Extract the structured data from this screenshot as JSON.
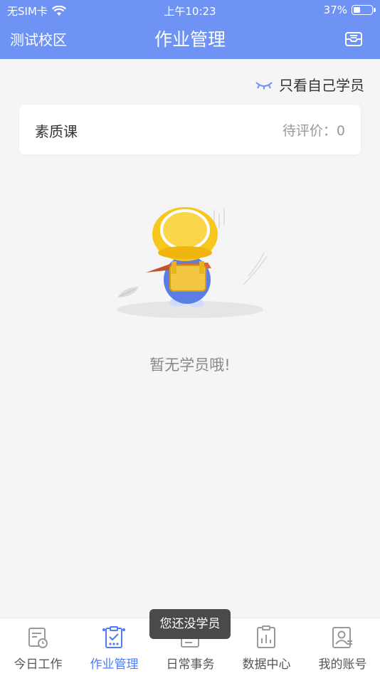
{
  "status_bar": {
    "carrier": "无SIM卡",
    "time": "上午10:23",
    "battery_percent": "37%",
    "battery_level": 0.37
  },
  "nav": {
    "left_label": "测试校区",
    "title": "作业管理",
    "right_icon": "mailbox-icon"
  },
  "filter": {
    "icon": "eye-closed-icon",
    "label": "只看自己学员"
  },
  "card": {
    "title": "素质课",
    "pending_label": "待评价：0"
  },
  "empty": {
    "message": "暂无学员哦!"
  },
  "toast": {
    "message": "您还没学员"
  },
  "tabbar": {
    "active_color": "#4e7cf2",
    "items": [
      {
        "label": "今日工作",
        "icon": "today-work-icon"
      },
      {
        "label": "作业管理",
        "icon": "homework-icon"
      },
      {
        "label": "日常事务",
        "icon": "daily-tasks-icon"
      },
      {
        "label": "数据中心",
        "icon": "data-center-icon"
      },
      {
        "label": "我的账号",
        "icon": "account-icon"
      }
    ]
  },
  "colors": {
    "header": "#6e93f5",
    "background": "#f5f5f7"
  }
}
